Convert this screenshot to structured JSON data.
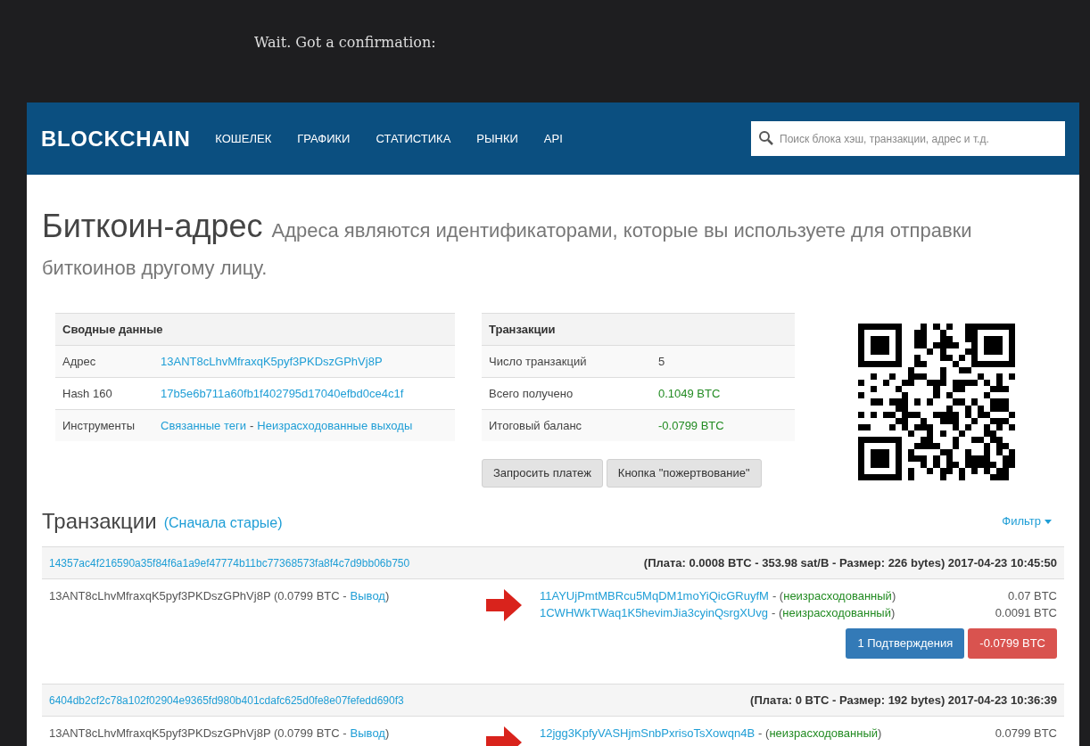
{
  "caption": "Wait. Got a confirmation:",
  "navbar": {
    "logo": "BLOCKCHAIN",
    "items": [
      "КОШЕЛЕК",
      "ГРАФИКИ",
      "СТАТИСТИКА",
      "РЫНКИ",
      "API"
    ],
    "search": {
      "placeholder": "Поиск блока хэш, транзакции, адрес и т.д."
    }
  },
  "heading": {
    "title": "Биткоин-адрес",
    "subtitle": "Адреса являются идентификаторами, которые вы используете для отправки биткоинов другому лицу."
  },
  "summary": {
    "title": "Сводные данные",
    "rows": [
      {
        "label": "Адрес",
        "links": [
          "13ANT8cLhvMfraxqK5pyf3PKDszGPhVj8P"
        ]
      },
      {
        "label": "Hash 160",
        "links": [
          "17b5e6b711a60fb1f402795d17040efbd0ce4c1f"
        ]
      },
      {
        "label": "Инструменты",
        "links": [
          "Связанные теги",
          "Неизрасходованные выходы"
        ],
        "separator": "-"
      }
    ]
  },
  "transactions_table": {
    "title": "Транзакции",
    "rows": [
      {
        "label": "Число транзакций",
        "value": "5",
        "positive": false
      },
      {
        "label": "Всего получено",
        "value": "0.1049 BTC",
        "positive": true
      },
      {
        "label": "Итоговый баланс",
        "value": "-0.0799 BTC",
        "positive": true
      }
    ],
    "buttons": [
      "Запросить платеж",
      "Кнопка \"пожертвование\""
    ]
  },
  "tx_section": {
    "title": "Транзакции",
    "order_link": "(Сначала старые)",
    "filter": "Фильтр"
  },
  "transactions": [
    {
      "hash": "14357ac4f216590a35f84f6a1a9ef47774b11bc77368573fa8f4c7d9bb06b750",
      "meta": "(Плата: 0.0008 BTC - 353.98 sat/B - Размер: 226 bytes) 2017-04-23 10:45:50",
      "from": {
        "address": "13ANT8cLhvMfraxqK5pyf3PKDszGPhVj8P",
        "amount": "(0.0799 BTC -",
        "link": "Вывод",
        "close": ")"
      },
      "outputs": [
        {
          "address": "11AYUjPmtMBRcu5MqDM1moYiQicGRuyfM",
          "open": "- (",
          "status": "неизрасходованный",
          "close": ")",
          "amount": "0.07 BTC"
        },
        {
          "address": "1CWHWkTWaq1K5hevimJia3cyinQsrgXUvg",
          "open": "- (",
          "status": "неизрасходованный",
          "close": ")",
          "amount": "0.0091 BTC"
        }
      ],
      "confirmations": "1 Подтверждения",
      "total": "-0.0799 BTC"
    },
    {
      "hash": "6404db2cf2c78a102f02904e9365fd980b401cdafc625d0fe8e07fefedd690f3",
      "meta": "(Плата: 0 BTC - Размер: 192 bytes) 2017-04-23 10:36:39",
      "from": {
        "address": "13ANT8cLhvMfraxqK5pyf3PKDszGPhVj8P",
        "amount": "(0.0799 BTC -",
        "link": "Вывод",
        "close": ")"
      },
      "outputs": [
        {
          "address": "12jgg3KpfyVASHjmSnbPxrisoTsXowqn4B",
          "open": "- (",
          "status": "неизрасходованный",
          "close": ")",
          "amount": "0.0799 BTC"
        }
      ]
    }
  ]
}
